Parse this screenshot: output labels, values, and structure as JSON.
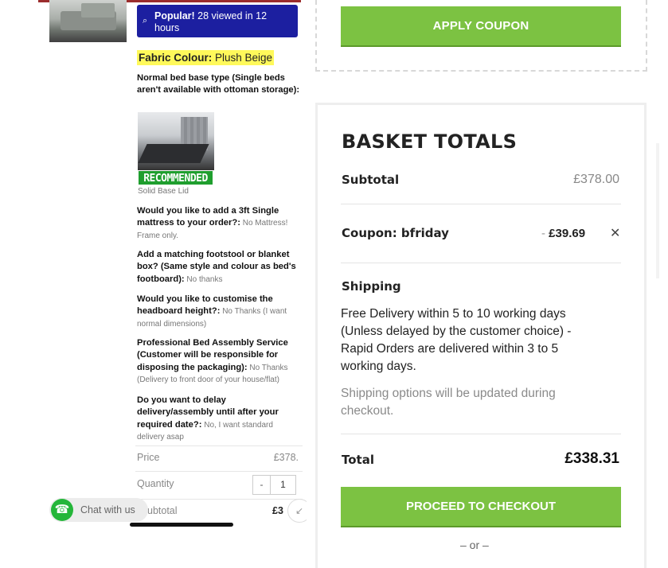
{
  "product": {
    "popular_badge": {
      "strong": "Popular!",
      "text": " 28 viewed in 12 hours"
    },
    "fabric_label": "Fabric Colour:",
    "fabric_value": " Plush Beige",
    "base_type_question": "Normal bed base type (Single beds aren't available with ottoman storage):",
    "recommended_badge": "RECOMMENDED",
    "base_choice": "Solid Base Lid",
    "options": [
      {
        "q": "Would you like to add a 3ft Single mattress to your order?:",
        "a": " No Mattress! Frame only."
      },
      {
        "q": "Add a matching footstool or blanket box? (Same style and colour as bed's footboard):",
        "a": " No thanks"
      },
      {
        "q": "Would you like to customise the headboard height?:",
        "a": " No Thanks (I want normal dimensions)"
      },
      {
        "q": "Professional Bed Assembly Service (Customer will be responsible for disposing the packaging):",
        "a": " No Thanks (Delivery to front door of your house/flat)"
      },
      {
        "q": "Do you want to delay delivery/assembly until after your required date?:",
        "a": " No, I want standard delivery asap"
      }
    ],
    "price_label": "Price",
    "price_value": "£378.",
    "quantity_label": "Quantity",
    "quantity_minus": "-",
    "quantity_value": "1",
    "subtotal_label": "ubtotal",
    "subtotal_value": "£3",
    "chat_label": "Chat with us"
  },
  "coupon": {
    "apply_label": "APPLY COUPON"
  },
  "basket": {
    "title": "BASKET TOTALS",
    "subtotal_label": "Subtotal",
    "subtotal_value": "£378.00",
    "coupon_label": "Coupon: bfriday",
    "coupon_dash": "- ",
    "coupon_value": "£39.69",
    "remove_icon": "✕",
    "shipping_label": "Shipping",
    "shipping_text": "Free Delivery within 5 to 10 working days (Unless delayed by the customer choice) - Rapid Orders are delivered within 3 to 5 working days.",
    "shipping_note": "Shipping options will be updated during checkout.",
    "total_label": "Total",
    "total_value": "£338.31",
    "checkout_label": "PROCEED TO CHECKOUT",
    "or_text": "– or –"
  },
  "colors": {
    "accent_green": "#7cc242",
    "popular_blue": "#1c1fa0",
    "highlight_yellow": "#fff95a",
    "recommended_green": "#1f9e2e"
  },
  "icons": {
    "search": "search-icon",
    "whatsapp": "whatsapp-icon",
    "remove": "close-icon"
  }
}
